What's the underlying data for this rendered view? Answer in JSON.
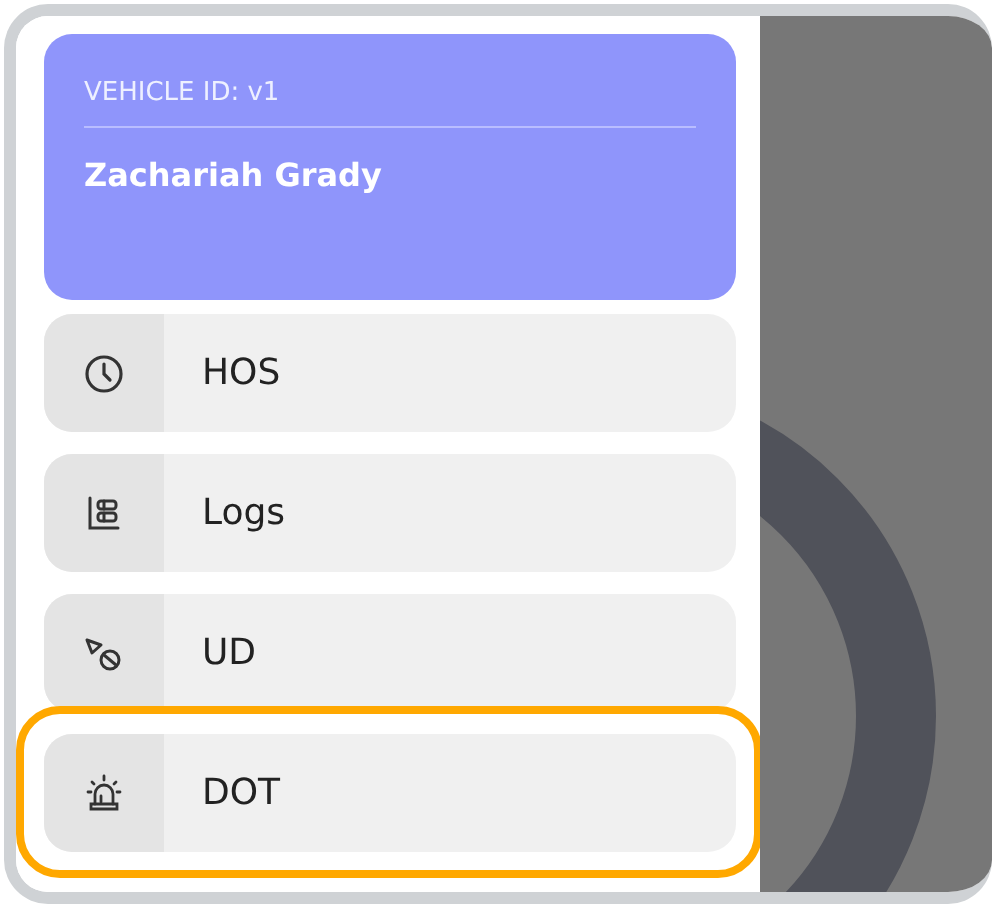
{
  "header": {
    "vehicle_id": "VEHICLE ID: v1",
    "driver": "Zachariah Grady"
  },
  "menu": [
    {
      "kind": "clock",
      "label": "HOS",
      "highlighted": false
    },
    {
      "kind": "logs",
      "label": "Logs",
      "highlighted": false
    },
    {
      "kind": "ud",
      "label": "UD",
      "highlighted": false
    },
    {
      "kind": "siren",
      "label": "DOT",
      "highlighted": true
    }
  ]
}
